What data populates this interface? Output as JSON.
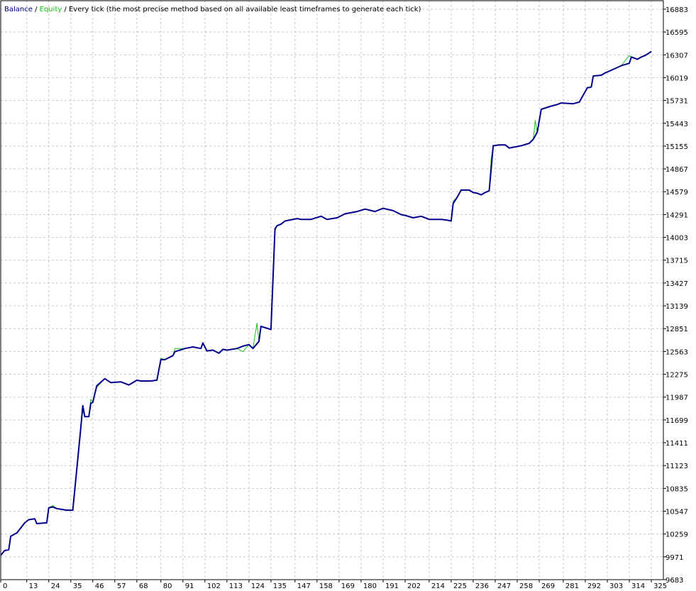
{
  "legend": {
    "balance": "Balance",
    "equity": "Equity",
    "sep": " / ",
    "description": "Every tick (the most precise method based on all available least timeframes to generate each tick)"
  },
  "colors": {
    "balance": "#00008b",
    "equity": "#1fbf1f",
    "grid": "#c8c8c8",
    "frame": "#000000"
  },
  "chart_data": {
    "type": "line",
    "grid": true,
    "legend_position": "top-left",
    "x_ticks": [
      0,
      13,
      24,
      35,
      46,
      57,
      68,
      80,
      91,
      102,
      113,
      124,
      135,
      147,
      158,
      169,
      180,
      191,
      202,
      214,
      225,
      236,
      247,
      258,
      269,
      281,
      292,
      303,
      314,
      325
    ],
    "y_ticks": [
      9683,
      9971,
      10259,
      10547,
      10835,
      11123,
      11411,
      11699,
      11987,
      12275,
      12563,
      12851,
      13139,
      13427,
      13715,
      14003,
      14291,
      14579,
      14867,
      15155,
      15443,
      15731,
      16019,
      16307,
      16595,
      16883
    ],
    "xlim": [
      0,
      331
    ],
    "ylim": [
      9683,
      16990
    ],
    "series": [
      {
        "name": "Balance",
        "x": [
          0,
          2,
          4,
          5,
          7,
          8,
          12,
          14,
          17,
          18,
          23,
          24,
          26,
          28,
          33,
          36,
          40,
          41,
          42,
          44,
          45,
          46,
          48,
          52,
          55,
          60,
          64,
          68,
          70,
          75,
          78,
          80,
          82,
          86,
          87,
          92,
          96,
          100,
          101,
          103,
          106,
          109,
          111,
          113,
          118,
          121,
          124,
          126,
          129,
          130,
          135,
          137,
          138,
          140,
          142,
          148,
          150,
          155,
          160,
          163,
          168,
          172,
          178,
          182,
          187,
          191,
          196,
          200,
          202,
          206,
          210,
          214,
          220,
          223,
          225,
          226,
          228,
          230,
          234,
          236,
          238,
          240,
          242,
          244,
          246,
          249,
          252,
          254,
          260,
          264,
          266,
          268,
          270,
          275,
          278,
          280,
          286,
          289,
          293,
          295,
          296,
          300,
          302,
          303,
          310,
          314,
          315,
          318,
          320,
          322,
          325
        ],
        "y": [
          9990,
          10050,
          10060,
          10230,
          10260,
          10270,
          10400,
          10440,
          10450,
          10390,
          10400,
          10590,
          10600,
          10580,
          10560,
          10560,
          11600,
          11880,
          11740,
          11740,
          11910,
          11920,
          12130,
          12220,
          12170,
          12180,
          12140,
          12200,
          12190,
          12190,
          12200,
          12460,
          12460,
          12510,
          12560,
          12600,
          12620,
          12600,
          12670,
          12570,
          12580,
          12540,
          12590,
          12580,
          12600,
          12630,
          12650,
          12600,
          12690,
          12880,
          12840,
          14110,
          14150,
          14170,
          14210,
          14240,
          14230,
          14230,
          14270,
          14230,
          14250,
          14300,
          14330,
          14360,
          14330,
          14370,
          14340,
          14290,
          14280,
          14250,
          14270,
          14230,
          14230,
          14220,
          14210,
          14430,
          14510,
          14600,
          14600,
          14570,
          14560,
          14540,
          14570,
          14590,
          15160,
          15170,
          15170,
          15130,
          15160,
          15190,
          15240,
          15330,
          15620,
          15660,
          15680,
          15700,
          15690,
          15710,
          15890,
          15900,
          16040,
          16050,
          16080,
          16090,
          16170,
          16200,
          16280,
          16250,
          16280,
          16300,
          16350
        ]
      },
      {
        "name": "Equity",
        "x": [
          0,
          2,
          4,
          5,
          7,
          8,
          12,
          14,
          17,
          18,
          23,
          24,
          26,
          28,
          33,
          36,
          39,
          40,
          41,
          42,
          44,
          45,
          46,
          47,
          48,
          52,
          55,
          60,
          64,
          68,
          70,
          75,
          78,
          80,
          82,
          86,
          87,
          92,
          96,
          100,
          101,
          103,
          106,
          109,
          111,
          113,
          118,
          121,
          124,
          126,
          128,
          129,
          130,
          135,
          137,
          138,
          140,
          142,
          148,
          150,
          155,
          160,
          163,
          168,
          172,
          178,
          182,
          187,
          191,
          196,
          200,
          202,
          206,
          210,
          214,
          220,
          223,
          225,
          226,
          228,
          230,
          234,
          236,
          238,
          240,
          242,
          244,
          245,
          246,
          249,
          252,
          254,
          260,
          264,
          266,
          267,
          268,
          270,
          275,
          278,
          280,
          286,
          289,
          293,
          294,
          295,
          296,
          300,
          302,
          303,
          310,
          314,
          315,
          318,
          320,
          322,
          325
        ],
        "y": [
          9990,
          10050,
          10060,
          10230,
          10260,
          10270,
          10400,
          10440,
          10450,
          10390,
          10400,
          10590,
          10620,
          10580,
          10560,
          10560,
          11300,
          11650,
          11820,
          11740,
          11740,
          11960,
          11920,
          12050,
          12110,
          12220,
          12170,
          12180,
          12140,
          12200,
          12190,
          12190,
          12200,
          12480,
          12460,
          12510,
          12600,
          12600,
          12620,
          12600,
          12670,
          12570,
          12580,
          12540,
          12590,
          12580,
          12600,
          12560,
          12650,
          12600,
          12920,
          12690,
          12880,
          12840,
          14080,
          14150,
          14170,
          14210,
          14240,
          14230,
          14230,
          14270,
          14230,
          14250,
          14300,
          14330,
          14360,
          14330,
          14370,
          14340,
          14290,
          14280,
          14250,
          14270,
          14230,
          14230,
          14220,
          14210,
          14460,
          14510,
          14600,
          14600,
          14570,
          14560,
          14540,
          14570,
          14590,
          15000,
          15160,
          15170,
          15170,
          15130,
          15160,
          15190,
          15240,
          15480,
          15330,
          15620,
          15660,
          15680,
          15700,
          15690,
          15710,
          15900,
          15890,
          15900,
          16040,
          16050,
          16080,
          16090,
          16170,
          16300,
          16280,
          16250,
          16280,
          16300,
          16350
        ]
      }
    ]
  }
}
